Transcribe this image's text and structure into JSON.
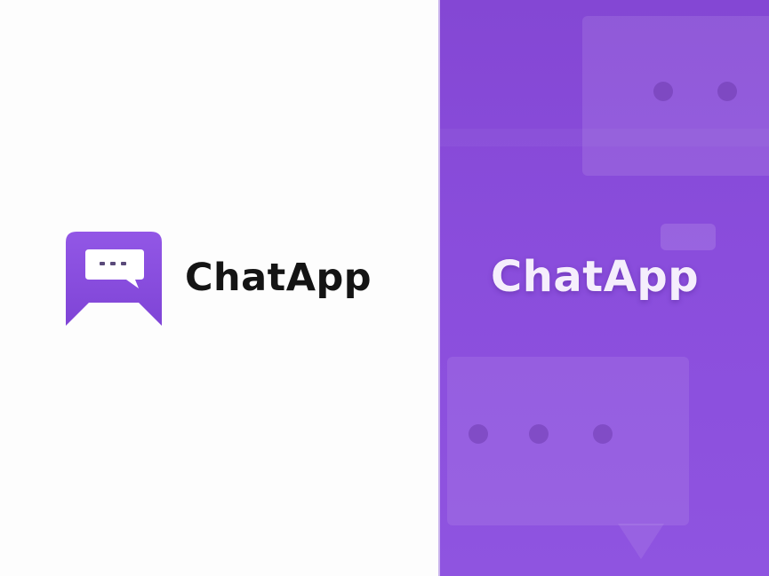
{
  "brand": {
    "name_on_light": "ChatApp",
    "name_on_dark": "ChatApp",
    "logo_icon": "chat-bubble-icon",
    "colors": {
      "primary_purple": "#8a4ddc",
      "logo_purple": "#8a4fe0",
      "light_background": "#fdfdfd",
      "dark_text": "#141414",
      "light_text": "#f5eefc"
    }
  }
}
